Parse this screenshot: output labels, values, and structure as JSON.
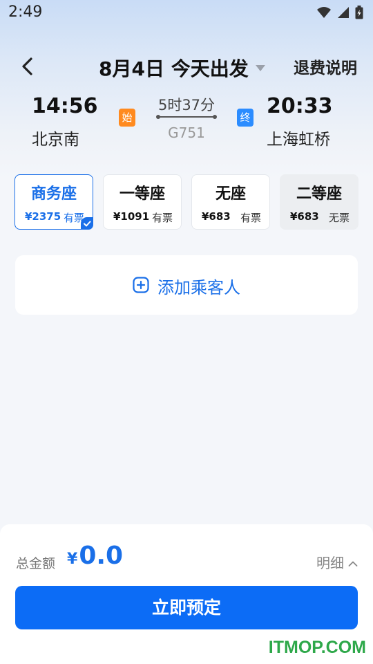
{
  "status_bar": {
    "time": "2:49"
  },
  "header": {
    "date_label": "8月4日 今天出发",
    "refund_label": "退费说明"
  },
  "train": {
    "departure": {
      "time": "14:56",
      "station": "北京南",
      "badge": "始"
    },
    "arrival": {
      "time": "20:33",
      "station": "上海虹桥",
      "badge": "终"
    },
    "duration": "5时37分",
    "number": "G751"
  },
  "seats": [
    {
      "name": "商务座",
      "price": "¥2375",
      "status": "有票",
      "selected": true
    },
    {
      "name": "一等座",
      "price": "¥1091",
      "status": "有票",
      "selected": false
    },
    {
      "name": "无座",
      "price": "¥683",
      "status": "有票",
      "selected": false
    },
    {
      "name": "二等座",
      "price": "¥683",
      "status": "无票",
      "selected": false
    }
  ],
  "add_passenger": {
    "label": "添加乘客人"
  },
  "footer": {
    "total_label": "总金额",
    "currency": "¥",
    "total_amount": "0.0",
    "detail_label": "明细",
    "book_button": "立即预定"
  },
  "watermark": "ITMOP.COM",
  "colors": {
    "accent": "#1a6fe8",
    "button": "#0c6cf6",
    "start_badge": "#ff8a1f",
    "end_badge": "#2b8cff",
    "watermark": "#2ea84a"
  }
}
